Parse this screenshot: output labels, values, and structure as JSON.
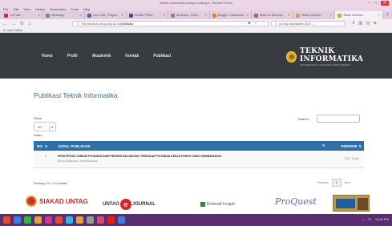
{
  "browser": {
    "window_title": "Teknik Informatika Untag Surabaya - Mozilla Firefox",
    "menu": [
      "File",
      "Edit",
      "View",
      "History",
      "Bookmarks",
      "Tools",
      "Help"
    ],
    "tabs": [
      {
        "label": "YouTube",
        "color": "#e62117",
        "active": false
      },
      {
        "label": "WhatsApp",
        "color": "#2bb741",
        "active": false
      },
      {
        "label": "Live Chat - Pangon",
        "color": "#2a73c9",
        "active": false
      },
      {
        "label": "Monitor Perfor...",
        "color": "#3f51b5",
        "active": false
      },
      {
        "label": "Surabaya - Desti...",
        "color": "#888888",
        "active": false
      },
      {
        "label": "Blogger - Dashboard",
        "color": "#f57d00",
        "active": false
      },
      {
        "label": "Buka-ins Minuman",
        "color": "#d44a7a",
        "active": false
      },
      {
        "label": "Teknik Informat...",
        "color": "#e0a722",
        "active": false
      },
      {
        "label": "Teknik Informat...",
        "color": "#e0a722",
        "active": true
      }
    ],
    "url_prefix": "informatika.untag-sby.ac.id/",
    "url_path": "publikasi",
    "search_text": "cd sby mamamia 2017 →",
    "bookmark_label": "Most Visited"
  },
  "site": {
    "menu": [
      "Home",
      "Profil",
      "Akademik",
      "Kontak",
      "Publikasi"
    ],
    "logo_title": "TEKNIK INFORMATIKA",
    "logo_subtitle": "UNIVERSITAS 17 AGUSTUS 1945 SURABAYA"
  },
  "page": {
    "title": "Publikasi Teknik Informatika",
    "show_label": "Show",
    "show_value": "10",
    "entries_label": "entries",
    "search_label": "Search:"
  },
  "table": {
    "headers": {
      "no": "NO.",
      "judul": "JUDUL PUBLIKASI",
      "periode": "PERIODE"
    },
    "rows": [
      {
        "no": "1",
        "judul": "EFEKTIFITAS VARIASI PUTARAN DARI PROSES BALANCING TERHADAP PUTARAN KERJA POROS YANG SEIMBANGNYA",
        "author": "Budiu Sulistyono, Arief Budiman",
        "periode": "2017 Gasal"
      }
    ],
    "info": "Showing 1 to 1 of 1 entries",
    "pager": {
      "previous": "Previous",
      "current": "1",
      "next": "Next"
    }
  },
  "footer_logos": {
    "siakad": "SIAKAD UNTAG",
    "untag_journal_left": "UNTAG",
    "untag_journal_letter": "e",
    "untag_journal_right": "JOURNAL",
    "emerald": "Emerald Insight",
    "proquest": "ProQuest"
  },
  "taskbar": {
    "icons": [
      "#e24a3a",
      "#3a7fe2",
      "#2bb741",
      "#e2a33a",
      "#c43a9a",
      "#e24a3a",
      "#3ab5e2",
      "#e2a33a",
      "#9a9a9a",
      "#d44a7a",
      "#e62117",
      "#3a7fe2"
    ],
    "tray_time": "12:05 PM"
  }
}
